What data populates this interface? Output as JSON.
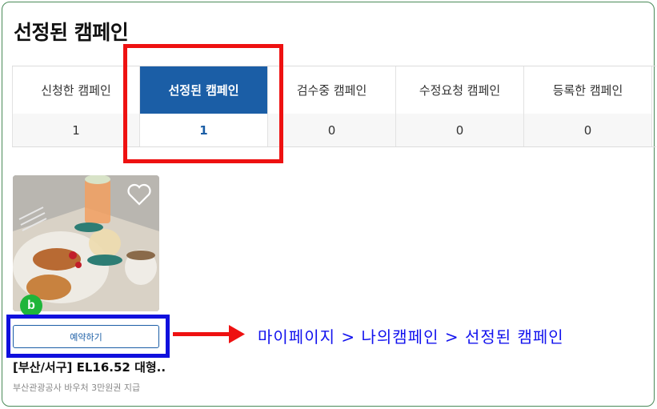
{
  "page": {
    "title": "선정된 캠페인"
  },
  "tabs": [
    {
      "label": "신청한 캠페인",
      "count": "1"
    },
    {
      "label": "선정된 캠페인",
      "count": "1"
    },
    {
      "label": "검수중 캠페인",
      "count": "0"
    },
    {
      "label": "수정요청 캠페인",
      "count": "0"
    },
    {
      "label": "등록한 캠페인",
      "count": "0"
    }
  ],
  "active_tab": 1,
  "campaign": {
    "badge": "b",
    "reserve_label": "예약하기",
    "title": "[부산/서구] EL16.52 대형...",
    "subtitle": "부산관광공사 바우처 3만원권 지급"
  },
  "annotation": {
    "caption": "마이페이지 > 나의캠페인 > 선정된 캠페인"
  },
  "colors": {
    "accent": "#1b5ea6",
    "highlight_red": "#ee1111",
    "highlight_blue": "#1010dd",
    "badge_green": "#1fb53a"
  },
  "icons": [
    "heart-icon",
    "arrow-right-icon"
  ]
}
